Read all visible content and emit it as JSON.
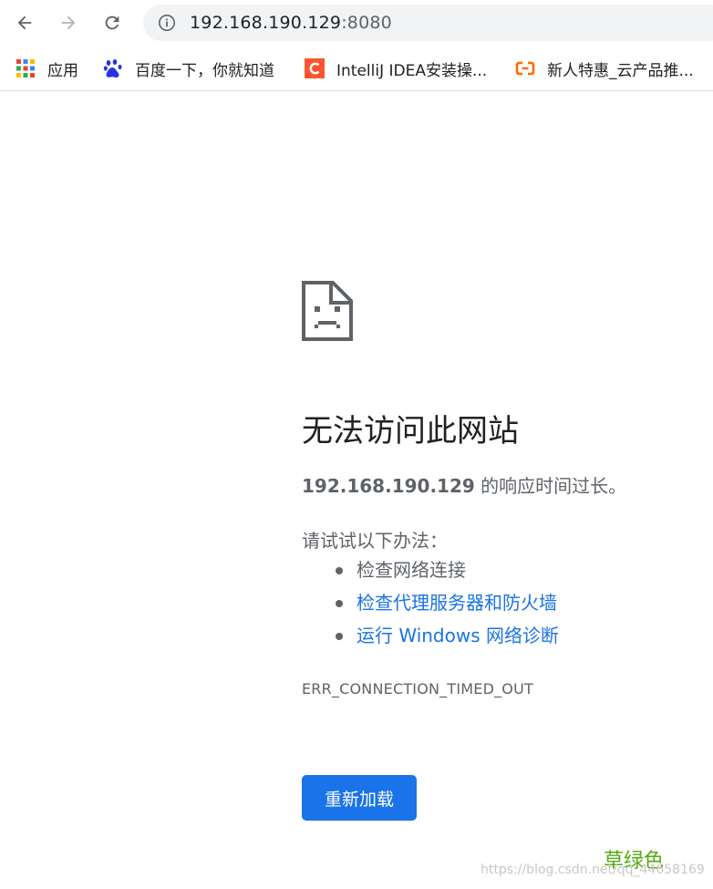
{
  "toolbar": {
    "address": {
      "host": "192.168.190.129",
      "port": ":8080"
    }
  },
  "bookmarks": [
    {
      "label": "应用",
      "icon": "apps-grid-icon"
    },
    {
      "label": "百度一下，你就知道",
      "icon": "baidu-paw-icon"
    },
    {
      "label": "IntelliJ IDEA安装操...",
      "icon": "csdn-c-icon"
    },
    {
      "label": "新人特惠_云产品推...",
      "icon": "aliyun-icon"
    }
  ],
  "error_page": {
    "icon": "sad-document-icon",
    "title": "无法访问此网站",
    "summary_host": "192.168.190.129",
    "summary_rest": " 的响应时间过长。",
    "try_label": "请试试以下办法：",
    "suggestions": [
      {
        "text": "检查网络连接",
        "link": false
      },
      {
        "text": "检查代理服务器和防火墙",
        "link": true
      },
      {
        "text": "运行 Windows 网络诊断",
        "link": true
      }
    ],
    "error_code": "ERR_CONNECTION_TIMED_OUT",
    "reload_label": "重新加载"
  },
  "overlay": {
    "watermark": "https://blog.csdn.net/qq_44658169",
    "stamp": "草绿色"
  },
  "colors": {
    "accent": "#1a73e8",
    "text_primary": "#202124",
    "text_secondary": "#5f6368",
    "omnibox_bg": "#f1f3f4"
  }
}
